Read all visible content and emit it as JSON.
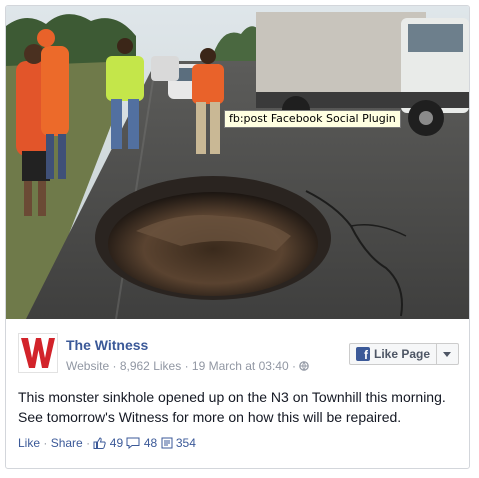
{
  "tooltip": {
    "text": "fb:post Facebook Social Plugin"
  },
  "page": {
    "name": "The Witness",
    "logo_letter": "W",
    "category": "Website",
    "likes": "8,962 Likes",
    "date": "19 March at 03:40",
    "separator": "·"
  },
  "like_button": {
    "label": "Like Page",
    "icon": "facebook-f-icon"
  },
  "post": {
    "text": "This monster sinkhole opened up on the N3 on Townhill this morning. See tomorrow's Witness for more on how this will be repaired."
  },
  "actions": {
    "like": "Like",
    "separator": "·",
    "share": "Share",
    "likes_count": "49",
    "comments_count": "48",
    "shares_count": "354"
  },
  "colors": {
    "link": "#3b5998",
    "meta": "#9197a3",
    "logo_red": "#d2232a",
    "tooltip_bg": "#ffffe1"
  }
}
